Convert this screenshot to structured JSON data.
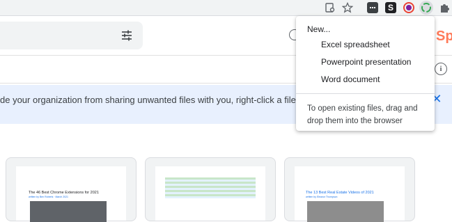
{
  "toolbar": {
    "icons": [
      "tab-search-icon",
      "star-icon",
      "extension-icon-dark",
      "extension-icon-s",
      "extension-icon-color-circle",
      "office-extension-icon",
      "puzzle-icon"
    ],
    "ext_s_letter": "S"
  },
  "drive": {
    "search_filter_icon": "tune-icon",
    "help_icon": "help-icon",
    "info_icon_glyph": "i",
    "brand_logo_text": "Sp",
    "banner_text": "de your organization from sharing unwanted files with you, right-click a file they've",
    "banner_close_glyph": "✕",
    "cards": [
      {
        "title": "The 46 Best Chrome Extensions for 2021",
        "sub": "written by Ben Roberts · March 2021"
      },
      {
        "title": "",
        "sub": ""
      },
      {
        "title": "The 13 Best Real Estate Videos of 2021",
        "sub": "written by Eleanor Thompson"
      }
    ]
  },
  "menu": {
    "new_label": "New...",
    "items": [
      "Excel spreadsheet",
      "Powerpoint presentation",
      "Word document"
    ],
    "hint": "To open existing files, drag and drop them into the browser"
  },
  "colors": {
    "banner_bg": "#e8f0fe",
    "accent": "#1a73e8",
    "brand": "#ff7a59"
  }
}
